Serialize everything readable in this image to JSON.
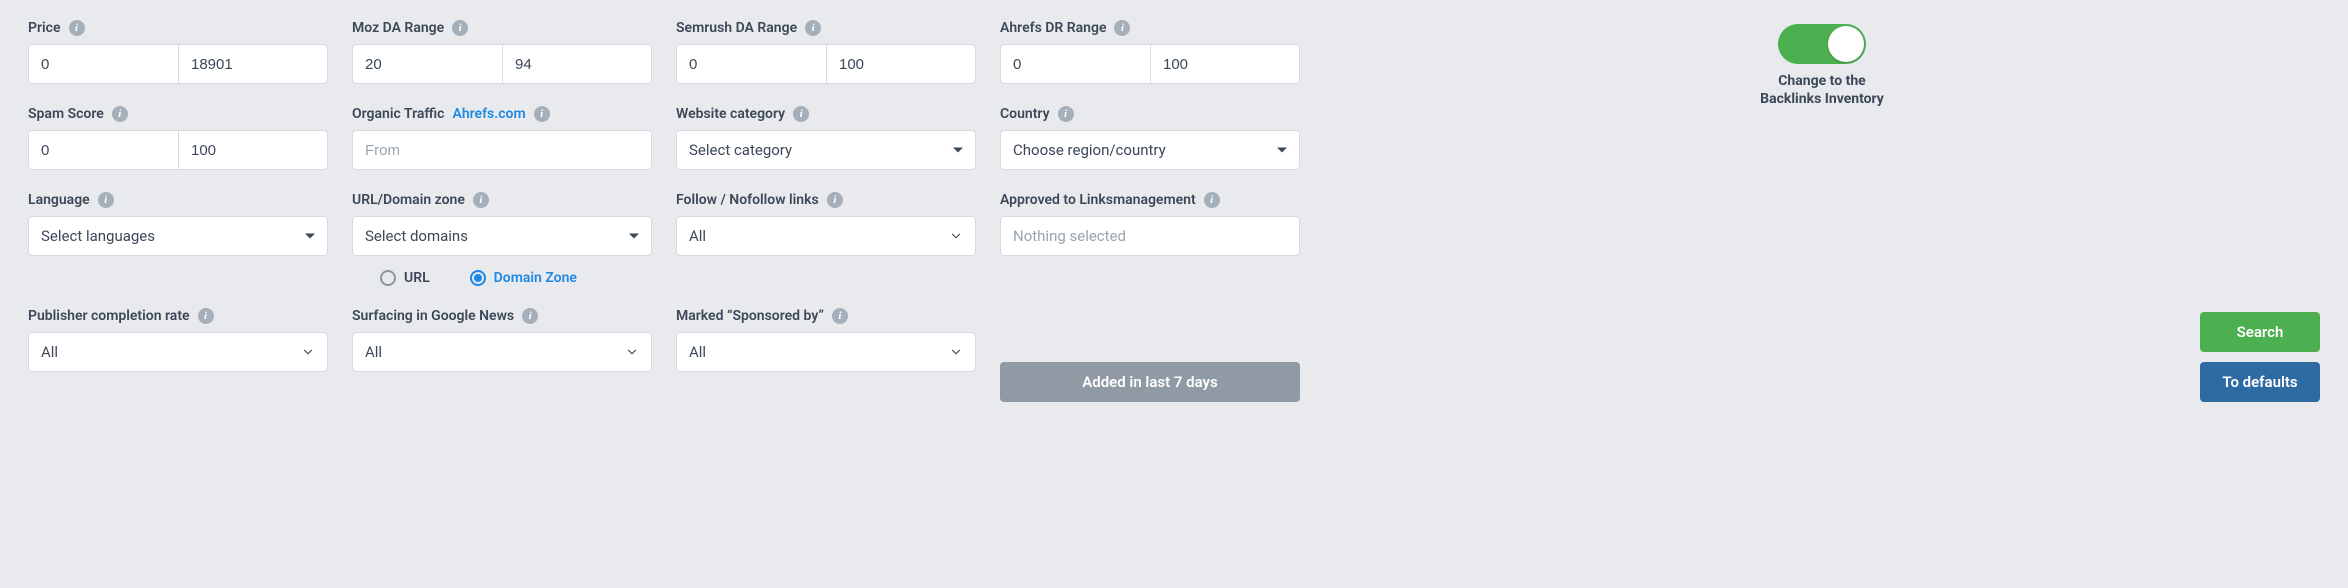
{
  "labels": {
    "price": "Price",
    "mozDA": "Moz DA Range",
    "semrushDA": "Semrush DA Range",
    "ahrefsDR": "Ahrefs DR Range",
    "spam": "Spam Score",
    "organicPrefix": "Organic Traffic ",
    "organicLink": "Ahrefs.com",
    "category": "Website category",
    "country": "Country",
    "language": "Language",
    "urlDomain": "URL/Domain zone",
    "follow": "Follow / Nofollow links",
    "approved": "Approved to Linksmanagement",
    "pubRate": "Publisher completion rate",
    "gnews": "Surfacing in Google News",
    "sponsored": "Marked “Sponsored by”"
  },
  "values": {
    "priceMin": "0",
    "priceMax": "18901",
    "mozMin": "20",
    "mozMax": "94",
    "semMin": "0",
    "semMax": "100",
    "ahrMin": "0",
    "ahrMax": "100",
    "spamMin": "0",
    "spamMax": "100",
    "organicFromPh": "From",
    "categoryPh": "Select category",
    "countryPh": "Choose region/country",
    "languagePh": "Select languages",
    "domainPh": "Select domains",
    "followVal": "All",
    "approvedPh": "Nothing selected",
    "pubRateVal": "All",
    "gnewsVal": "All",
    "sponsoredVal": "All",
    "addedBtn": "Added in last 7 days"
  },
  "radios": {
    "url": "URL",
    "domainZone": "Domain Zone"
  },
  "side": {
    "toggleLabel1": "Change to the",
    "toggleLabel2": "Backlinks Inventory",
    "search": "Search",
    "defaults": "To defaults"
  }
}
